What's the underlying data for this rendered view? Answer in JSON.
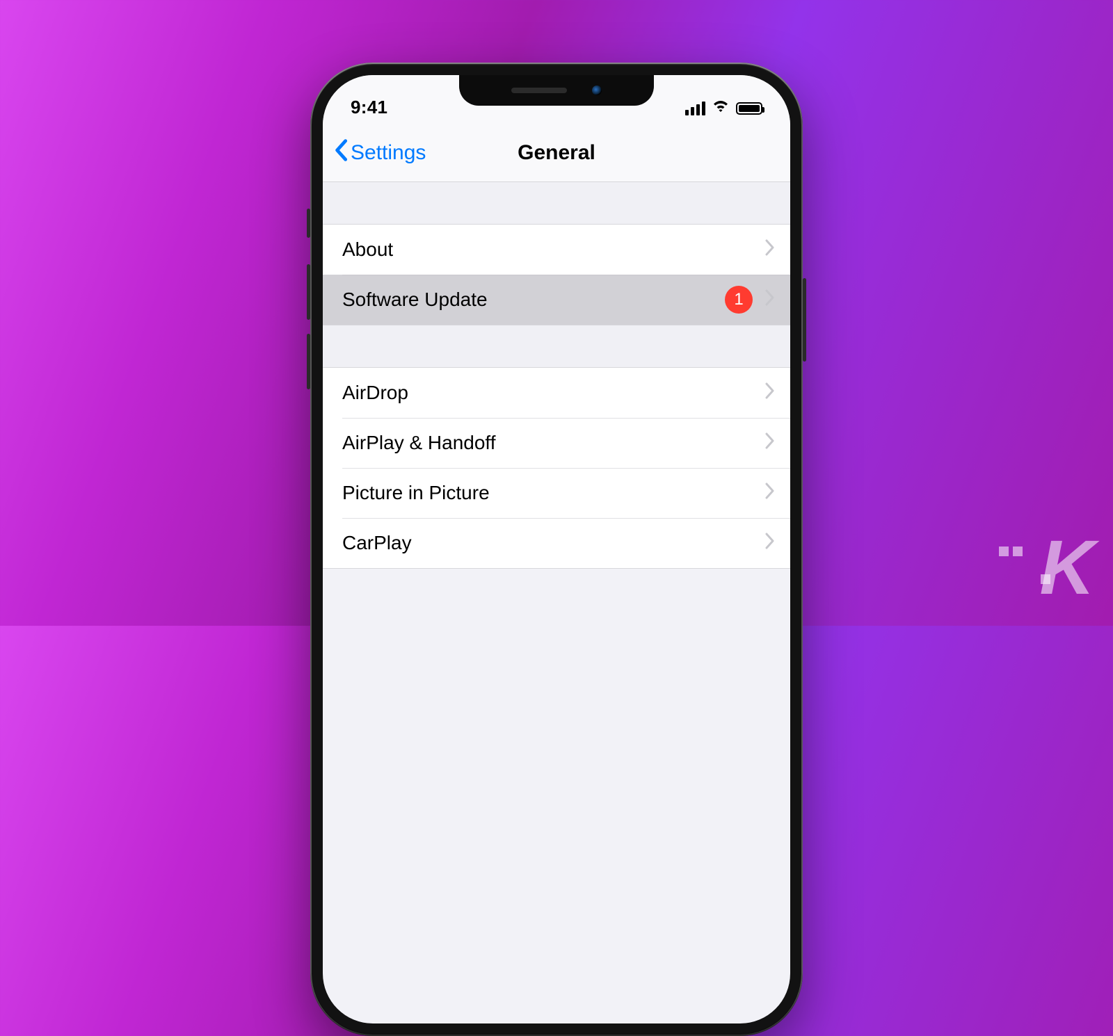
{
  "status": {
    "time": "9:41"
  },
  "nav": {
    "back_label": "Settings",
    "title": "General"
  },
  "sections": [
    {
      "rows": [
        {
          "label": "About",
          "badge": null,
          "highlight": false
        },
        {
          "label": "Software Update",
          "badge": "1",
          "highlight": true
        }
      ]
    },
    {
      "rows": [
        {
          "label": "AirDrop",
          "badge": null,
          "highlight": false
        },
        {
          "label": "AirPlay & Handoff",
          "badge": null,
          "highlight": false
        },
        {
          "label": "Picture in Picture",
          "badge": null,
          "highlight": false
        },
        {
          "label": "CarPlay",
          "badge": null,
          "highlight": false
        }
      ]
    }
  ],
  "watermark": "K"
}
